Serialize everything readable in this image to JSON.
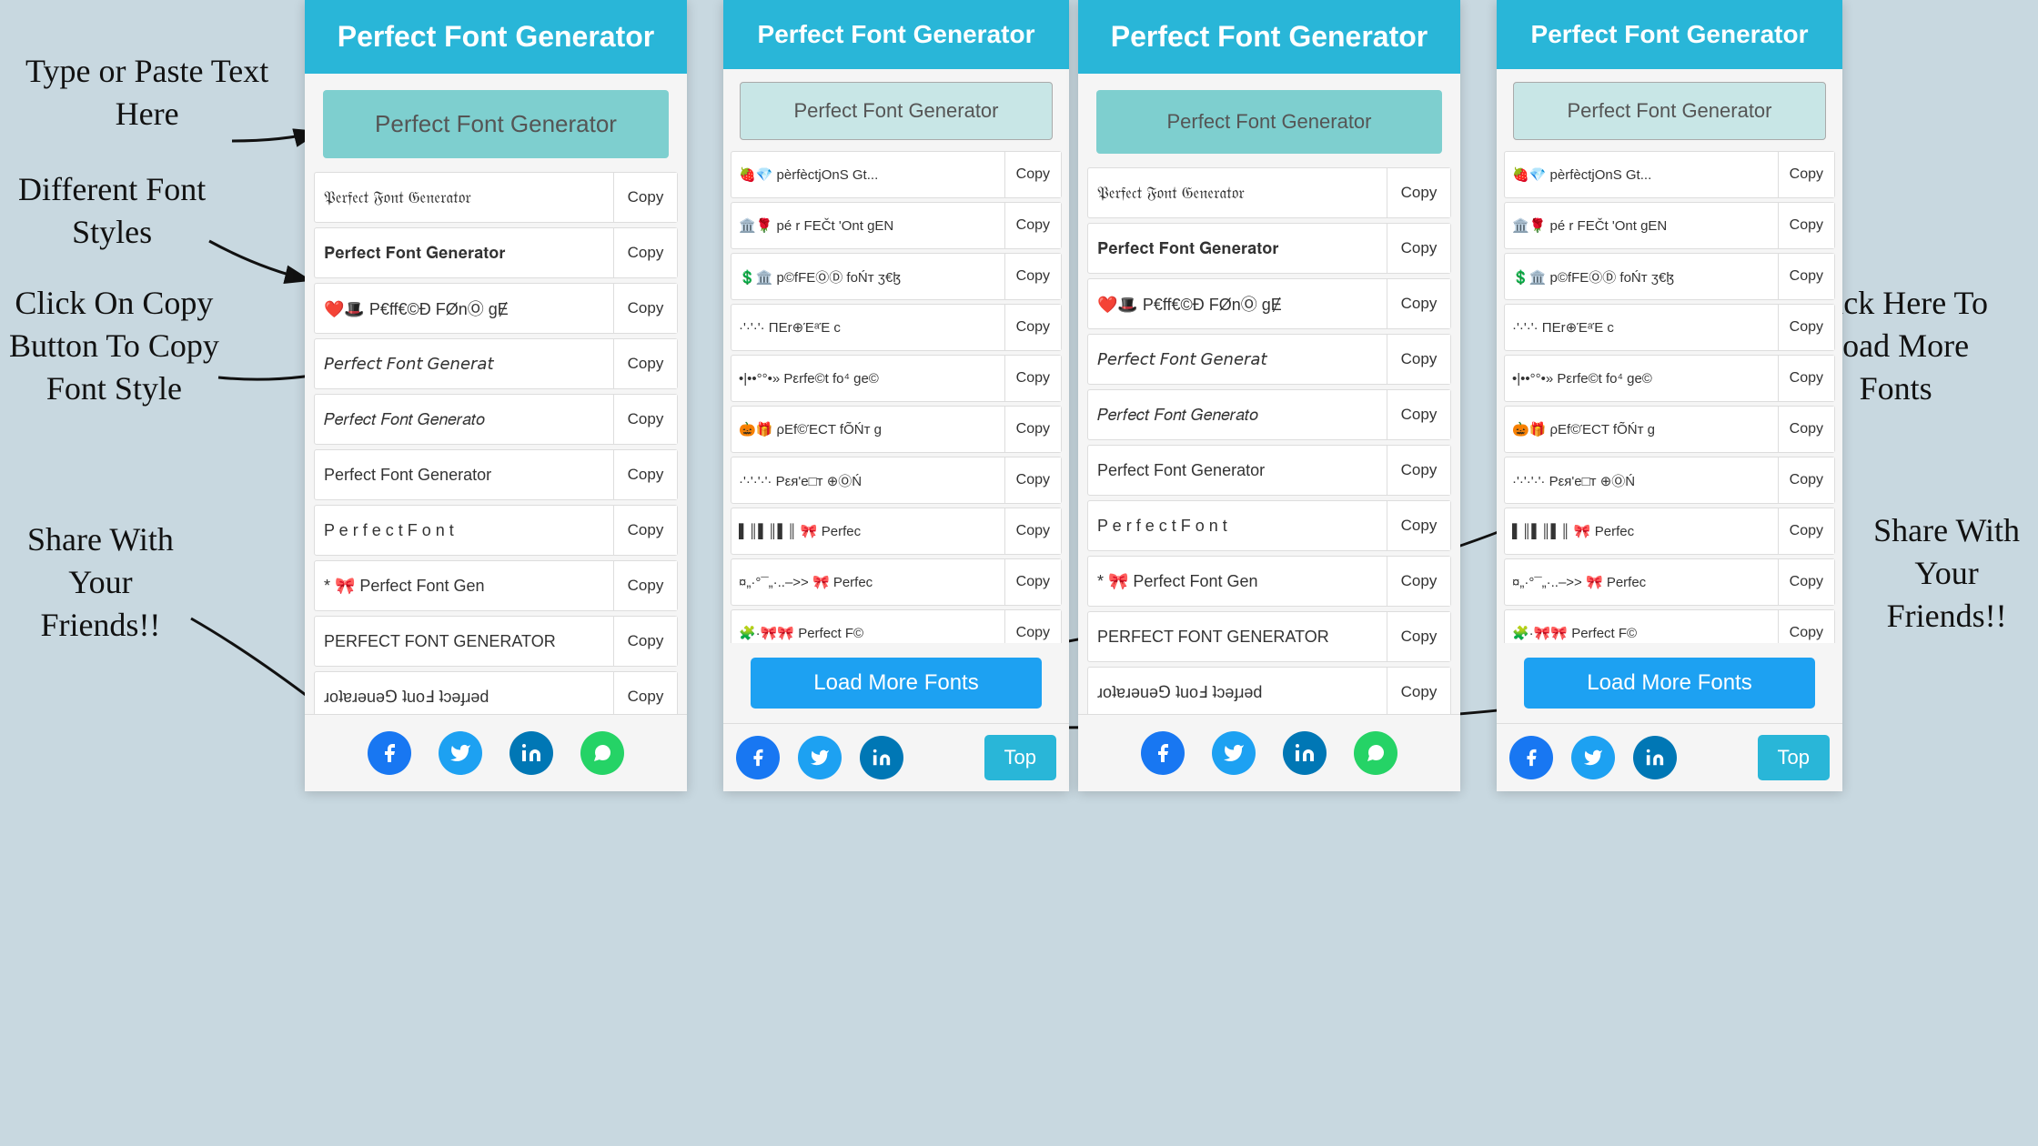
{
  "app": {
    "title": "Perfect Font Generator"
  },
  "annotations": {
    "type_paste": "Type or Paste Text\nHere",
    "different_fonts": "Different Font\nStyles",
    "click_copy": "Click On Copy\nButton To Copy\nFont Style",
    "share_friends_left": "Share With\nYour\nFriends!!",
    "click_load_more": "Click Here To\nLoad More\nFonts",
    "share_friends_right": "Share With\nYour\nFriends!!"
  },
  "left_panel": {
    "header": "Perfect Font Generator",
    "input_placeholder": "Perfect Font Generator",
    "fonts": [
      {
        "text": "𝔓𝔢𝔯𝔣𝔢𝔠𝔱 𝔉𝔬𝔫𝔱 𝔊𝔢𝔫𝔢𝔯𝔞𝔱𝔬𝔯",
        "copy": "Copy"
      },
      {
        "text": "𝐏𝐞𝐫𝐟𝐞𝐜𝐭 𝐅𝐨𝐧𝐭 𝐆𝐞𝐧𝐞𝐫𝐚𝐭𝐨𝐫",
        "copy": "Copy"
      },
      {
        "text": "❤️🎩 P€ff€©Ð FØnⓄ gɆ",
        "copy": "Copy"
      },
      {
        "text": "𝘗𝘦𝘳𝘧𝘦𝘤𝘵 𝘍𝘰𝘯𝘵 𝘎𝘦𝘯𝘦𝘳𝘢𝘵",
        "copy": "Copy"
      },
      {
        "text": "𝑃𝑒𝑟𝑓𝑒𝑐𝑡 𝐹𝑜𝑛𝑡 𝐺𝑒𝑛𝑒𝑟𝑎𝑡𝑜",
        "copy": "Copy"
      },
      {
        "text": "Perfect Font Generator",
        "copy": "Copy",
        "class": "font-spaced"
      },
      {
        "text": "P e r f e c t  F o n t",
        "copy": "Copy",
        "class": "font-spaced"
      },
      {
        "text": "* 🎀 Perfect Font Gen",
        "copy": "Copy"
      },
      {
        "text": "PERFECT FONT GENERATOR",
        "copy": "Copy",
        "class": "font-uppercase"
      },
      {
        "text": "ɹoʇɐɹǝuǝ⅁ ʇuoℲ ʇɔǝɟɹǝd",
        "copy": "Copy"
      }
    ],
    "share": {
      "facebook": "f",
      "twitter": "🐦",
      "linkedin": "in",
      "whatsapp": "✔"
    }
  },
  "right_panel": {
    "header": "Perfect Font Generator",
    "input_placeholder": "Perfect Font Generator",
    "fonts": [
      {
        "text": "🍓💎 pèrfèctjOnS Gt...",
        "copy": "Copy"
      },
      {
        "text": "🏛️🌹 pé r FEČt 'Ont gEN",
        "copy": "Copy"
      },
      {
        "text": "💲🏛️ p©fFEⓄⒹ foŃт ʒ€ɮ",
        "copy": "Copy"
      },
      {
        "text": "·'·'·'· ΠΕr⊕ΈᵃΈ c",
        "copy": "Copy"
      },
      {
        "text": "•|••°°•»  Ρεrfe©t fo⁴ ge©",
        "copy": "Copy"
      },
      {
        "text": "🎃🎁 ρEf©ΈCΤ fÕŃт g",
        "copy": "Copy"
      },
      {
        "text": "·'·'·'·'· Ρεя'e□т ⊕ⓄŃ",
        "copy": "Copy"
      },
      {
        "text": "▌║▌║▌║ 🎀 Perfec",
        "copy": "Copy"
      },
      {
        "text": "¤„·°¯„·..–>> 🎀 Perfec",
        "copy": "Copy"
      },
      {
        "text": "🧩·🎀🎀 Perfect F©",
        "copy": "Copy"
      }
    ],
    "load_more": "Load More Fonts",
    "top": "Top",
    "share": {
      "facebook": "f",
      "twitter": "🐦",
      "linkedin": "in"
    }
  }
}
